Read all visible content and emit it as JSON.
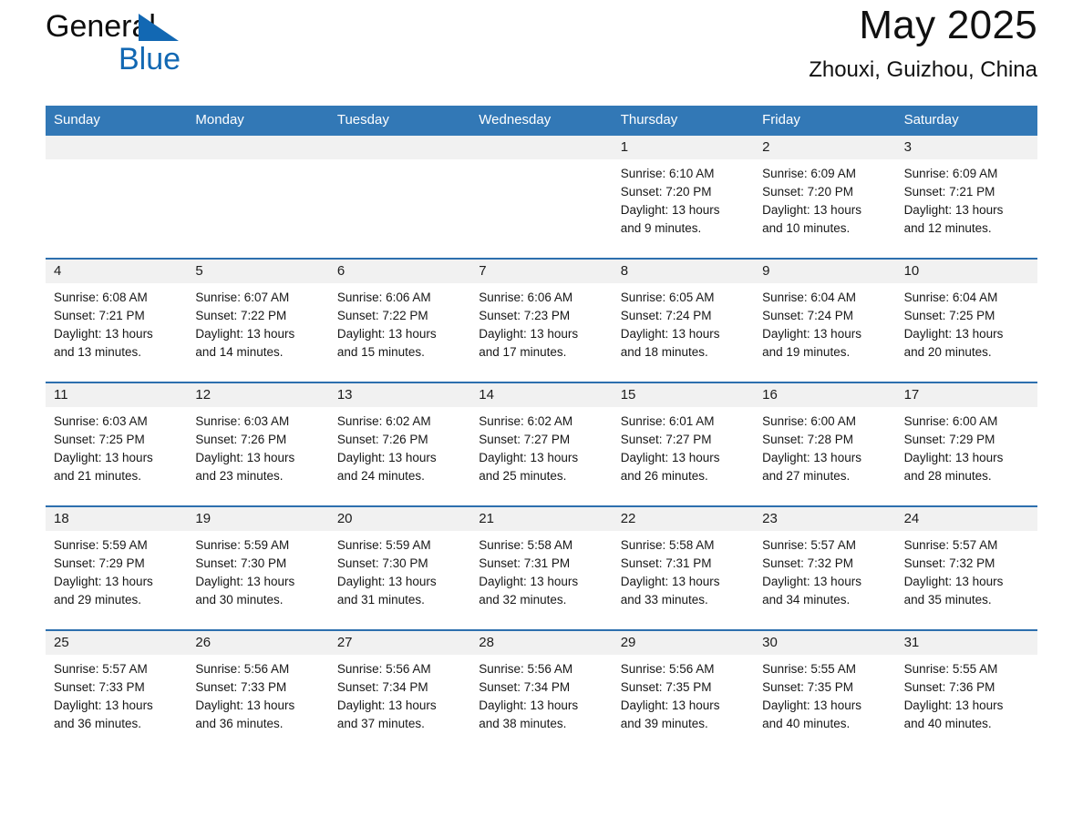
{
  "brand": {
    "name_top": "General",
    "name_bottom": "Blue",
    "triangle_color": "#1268b3"
  },
  "header": {
    "title": "May 2025",
    "subtitle": "Zhouxi, Guizhou, China"
  },
  "theme": {
    "header_blue": "#3278b6",
    "row_divider_blue": "#2d6fae",
    "daynum_band": "#f1f1f1",
    "text": "#171717"
  },
  "calendar": {
    "weekdays": [
      "Sunday",
      "Monday",
      "Tuesday",
      "Wednesday",
      "Thursday",
      "Friday",
      "Saturday"
    ],
    "weeks": [
      [
        {
          "day": "",
          "sunrise": "",
          "sunset": "",
          "daylight": "",
          "daylight2": ""
        },
        {
          "day": "",
          "sunrise": "",
          "sunset": "",
          "daylight": "",
          "daylight2": ""
        },
        {
          "day": "",
          "sunrise": "",
          "sunset": "",
          "daylight": "",
          "daylight2": ""
        },
        {
          "day": "",
          "sunrise": "",
          "sunset": "",
          "daylight": "",
          "daylight2": ""
        },
        {
          "day": "1",
          "sunrise": "Sunrise: 6:10 AM",
          "sunset": "Sunset: 7:20 PM",
          "daylight": "Daylight: 13 hours",
          "daylight2": "and 9 minutes."
        },
        {
          "day": "2",
          "sunrise": "Sunrise: 6:09 AM",
          "sunset": "Sunset: 7:20 PM",
          "daylight": "Daylight: 13 hours",
          "daylight2": "and 10 minutes."
        },
        {
          "day": "3",
          "sunrise": "Sunrise: 6:09 AM",
          "sunset": "Sunset: 7:21 PM",
          "daylight": "Daylight: 13 hours",
          "daylight2": "and 12 minutes."
        }
      ],
      [
        {
          "day": "4",
          "sunrise": "Sunrise: 6:08 AM",
          "sunset": "Sunset: 7:21 PM",
          "daylight": "Daylight: 13 hours",
          "daylight2": "and 13 minutes."
        },
        {
          "day": "5",
          "sunrise": "Sunrise: 6:07 AM",
          "sunset": "Sunset: 7:22 PM",
          "daylight": "Daylight: 13 hours",
          "daylight2": "and 14 minutes."
        },
        {
          "day": "6",
          "sunrise": "Sunrise: 6:06 AM",
          "sunset": "Sunset: 7:22 PM",
          "daylight": "Daylight: 13 hours",
          "daylight2": "and 15 minutes."
        },
        {
          "day": "7",
          "sunrise": "Sunrise: 6:06 AM",
          "sunset": "Sunset: 7:23 PM",
          "daylight": "Daylight: 13 hours",
          "daylight2": "and 17 minutes."
        },
        {
          "day": "8",
          "sunrise": "Sunrise: 6:05 AM",
          "sunset": "Sunset: 7:24 PM",
          "daylight": "Daylight: 13 hours",
          "daylight2": "and 18 minutes."
        },
        {
          "day": "9",
          "sunrise": "Sunrise: 6:04 AM",
          "sunset": "Sunset: 7:24 PM",
          "daylight": "Daylight: 13 hours",
          "daylight2": "and 19 minutes."
        },
        {
          "day": "10",
          "sunrise": "Sunrise: 6:04 AM",
          "sunset": "Sunset: 7:25 PM",
          "daylight": "Daylight: 13 hours",
          "daylight2": "and 20 minutes."
        }
      ],
      [
        {
          "day": "11",
          "sunrise": "Sunrise: 6:03 AM",
          "sunset": "Sunset: 7:25 PM",
          "daylight": "Daylight: 13 hours",
          "daylight2": "and 21 minutes."
        },
        {
          "day": "12",
          "sunrise": "Sunrise: 6:03 AM",
          "sunset": "Sunset: 7:26 PM",
          "daylight": "Daylight: 13 hours",
          "daylight2": "and 23 minutes."
        },
        {
          "day": "13",
          "sunrise": "Sunrise: 6:02 AM",
          "sunset": "Sunset: 7:26 PM",
          "daylight": "Daylight: 13 hours",
          "daylight2": "and 24 minutes."
        },
        {
          "day": "14",
          "sunrise": "Sunrise: 6:02 AM",
          "sunset": "Sunset: 7:27 PM",
          "daylight": "Daylight: 13 hours",
          "daylight2": "and 25 minutes."
        },
        {
          "day": "15",
          "sunrise": "Sunrise: 6:01 AM",
          "sunset": "Sunset: 7:27 PM",
          "daylight": "Daylight: 13 hours",
          "daylight2": "and 26 minutes."
        },
        {
          "day": "16",
          "sunrise": "Sunrise: 6:00 AM",
          "sunset": "Sunset: 7:28 PM",
          "daylight": "Daylight: 13 hours",
          "daylight2": "and 27 minutes."
        },
        {
          "day": "17",
          "sunrise": "Sunrise: 6:00 AM",
          "sunset": "Sunset: 7:29 PM",
          "daylight": "Daylight: 13 hours",
          "daylight2": "and 28 minutes."
        }
      ],
      [
        {
          "day": "18",
          "sunrise": "Sunrise: 5:59 AM",
          "sunset": "Sunset: 7:29 PM",
          "daylight": "Daylight: 13 hours",
          "daylight2": "and 29 minutes."
        },
        {
          "day": "19",
          "sunrise": "Sunrise: 5:59 AM",
          "sunset": "Sunset: 7:30 PM",
          "daylight": "Daylight: 13 hours",
          "daylight2": "and 30 minutes."
        },
        {
          "day": "20",
          "sunrise": "Sunrise: 5:59 AM",
          "sunset": "Sunset: 7:30 PM",
          "daylight": "Daylight: 13 hours",
          "daylight2": "and 31 minutes."
        },
        {
          "day": "21",
          "sunrise": "Sunrise: 5:58 AM",
          "sunset": "Sunset: 7:31 PM",
          "daylight": "Daylight: 13 hours",
          "daylight2": "and 32 minutes."
        },
        {
          "day": "22",
          "sunrise": "Sunrise: 5:58 AM",
          "sunset": "Sunset: 7:31 PM",
          "daylight": "Daylight: 13 hours",
          "daylight2": "and 33 minutes."
        },
        {
          "day": "23",
          "sunrise": "Sunrise: 5:57 AM",
          "sunset": "Sunset: 7:32 PM",
          "daylight": "Daylight: 13 hours",
          "daylight2": "and 34 minutes."
        },
        {
          "day": "24",
          "sunrise": "Sunrise: 5:57 AM",
          "sunset": "Sunset: 7:32 PM",
          "daylight": "Daylight: 13 hours",
          "daylight2": "and 35 minutes."
        }
      ],
      [
        {
          "day": "25",
          "sunrise": "Sunrise: 5:57 AM",
          "sunset": "Sunset: 7:33 PM",
          "daylight": "Daylight: 13 hours",
          "daylight2": "and 36 minutes."
        },
        {
          "day": "26",
          "sunrise": "Sunrise: 5:56 AM",
          "sunset": "Sunset: 7:33 PM",
          "daylight": "Daylight: 13 hours",
          "daylight2": "and 36 minutes."
        },
        {
          "day": "27",
          "sunrise": "Sunrise: 5:56 AM",
          "sunset": "Sunset: 7:34 PM",
          "daylight": "Daylight: 13 hours",
          "daylight2": "and 37 minutes."
        },
        {
          "day": "28",
          "sunrise": "Sunrise: 5:56 AM",
          "sunset": "Sunset: 7:34 PM",
          "daylight": "Daylight: 13 hours",
          "daylight2": "and 38 minutes."
        },
        {
          "day": "29",
          "sunrise": "Sunrise: 5:56 AM",
          "sunset": "Sunset: 7:35 PM",
          "daylight": "Daylight: 13 hours",
          "daylight2": "and 39 minutes."
        },
        {
          "day": "30",
          "sunrise": "Sunrise: 5:55 AM",
          "sunset": "Sunset: 7:35 PM",
          "daylight": "Daylight: 13 hours",
          "daylight2": "and 40 minutes."
        },
        {
          "day": "31",
          "sunrise": "Sunrise: 5:55 AM",
          "sunset": "Sunset: 7:36 PM",
          "daylight": "Daylight: 13 hours",
          "daylight2": "and 40 minutes."
        }
      ]
    ]
  }
}
